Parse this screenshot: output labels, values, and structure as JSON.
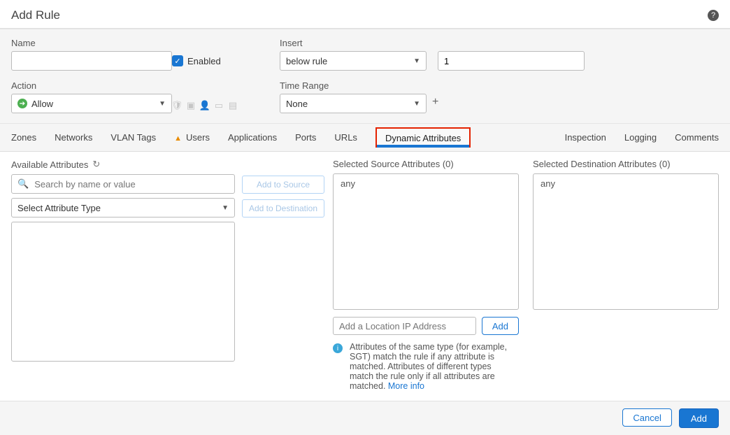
{
  "header": {
    "title": "Add Rule"
  },
  "form": {
    "name_label": "Name",
    "name_value": "",
    "enabled_label": "Enabled",
    "insert_label": "Insert",
    "insert_value": "below rule",
    "insert_position": "1",
    "action_label": "Action",
    "action_value": "Allow",
    "timerange_label": "Time Range",
    "timerange_value": "None"
  },
  "tabs": {
    "zones": "Zones",
    "networks": "Networks",
    "vlan": "VLAN Tags",
    "users": "Users",
    "applications": "Applications",
    "ports": "Ports",
    "urls": "URLs",
    "dynamic": "Dynamic Attributes",
    "inspection": "Inspection",
    "logging": "Logging",
    "comments": "Comments"
  },
  "available": {
    "title": "Available Attributes",
    "search_placeholder": "Search by name or value",
    "type_select": "Select Attribute Type"
  },
  "mid": {
    "add_source": "Add to Source",
    "add_dest": "Add to Destination"
  },
  "selected": {
    "source_title": "Selected Source Attributes (0)",
    "source_value": "any",
    "dest_title": "Selected Destination Attributes (0)",
    "dest_value": "any",
    "location_placeholder": "Add a Location IP Address",
    "location_add": "Add",
    "info_text": "Attributes of the same type (for example, SGT) match the rule if any attribute is matched. Attributes of different types match the rule only if all attributes are matched. ",
    "more_info": "More info"
  },
  "footer": {
    "cancel": "Cancel",
    "add": "Add"
  }
}
